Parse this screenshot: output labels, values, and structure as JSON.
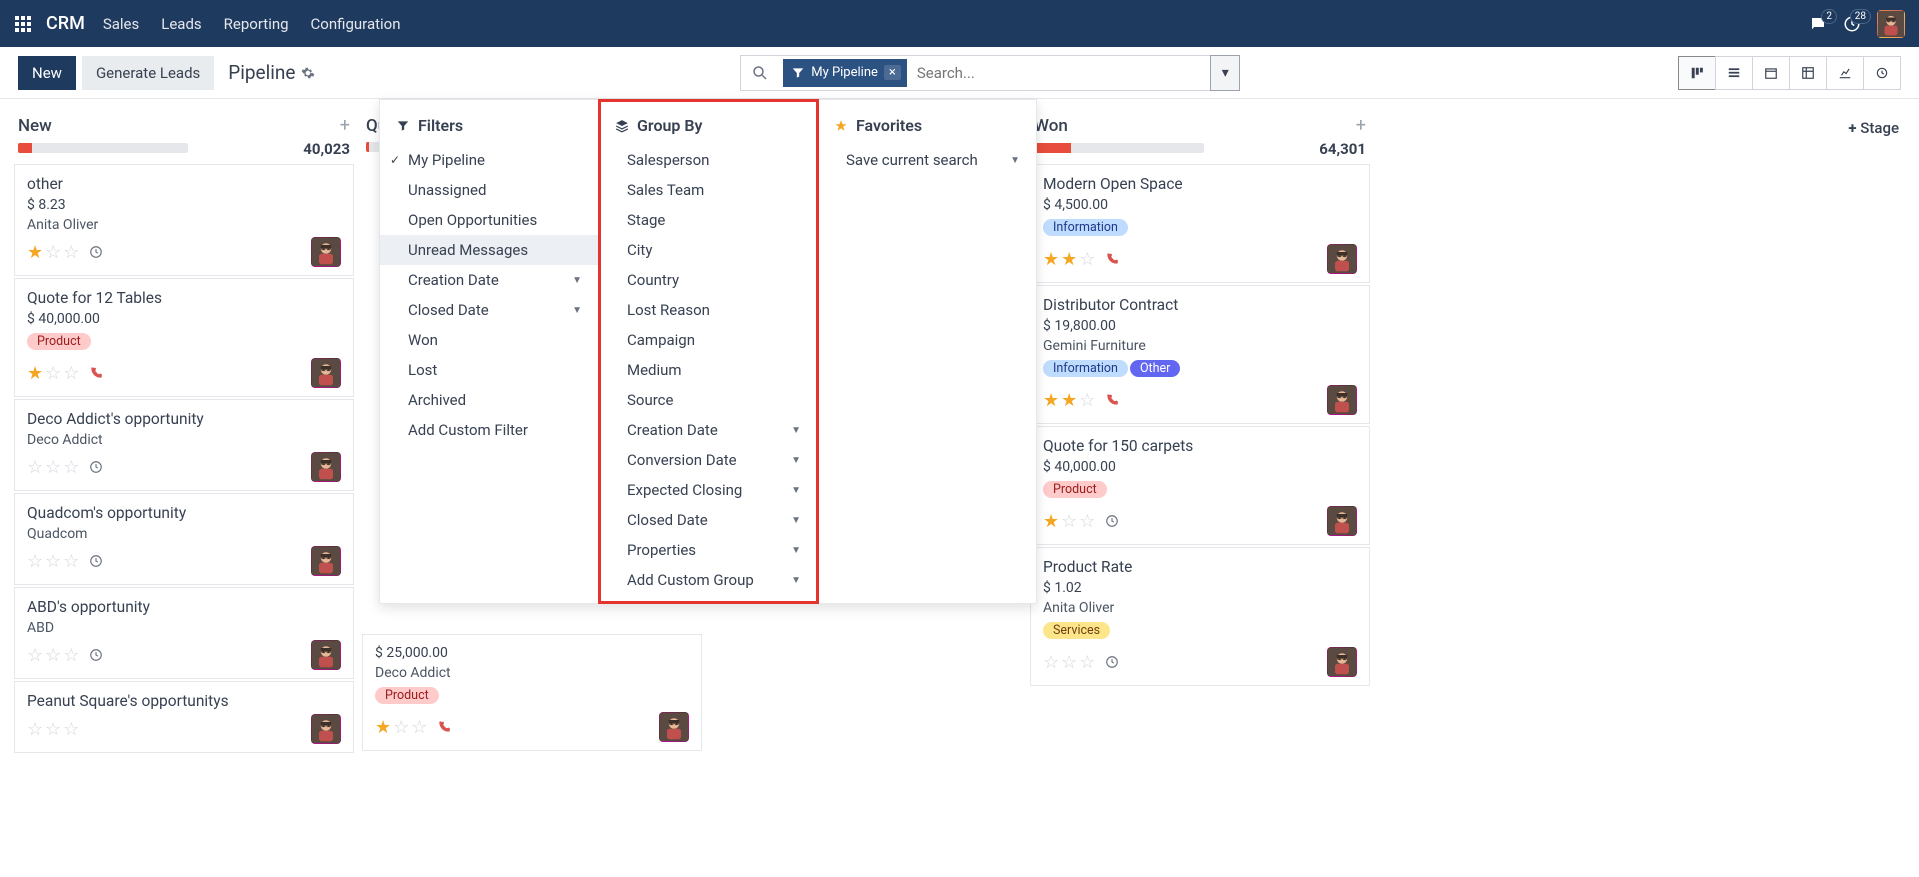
{
  "nav": {
    "brand": "CRM",
    "menu": [
      "Sales",
      "Leads",
      "Reporting",
      "Configuration"
    ],
    "msg_count": "2",
    "activity_count": "28"
  },
  "toolbar": {
    "new_label": "New",
    "generate_label": "Generate Leads",
    "title": "Pipeline",
    "chip_label": "My Pipeline",
    "search_placeholder": "Search...",
    "add_stage": "Stage"
  },
  "dropdown": {
    "filters_head": "Filters",
    "groupby_head": "Group By",
    "favorites_head": "Favorites",
    "filters": [
      {
        "label": "My Pipeline",
        "checked": true
      },
      {
        "label": "Unassigned"
      },
      {
        "label": "Open Opportunities"
      },
      {
        "label": "Unread Messages",
        "hovered": true
      },
      {
        "label": "Creation Date",
        "caret": true
      },
      {
        "label": "Closed Date",
        "caret": true
      },
      {
        "label": "Won"
      },
      {
        "label": "Lost"
      },
      {
        "label": "Archived"
      },
      {
        "label": "Add Custom Filter"
      }
    ],
    "groupby": [
      {
        "label": "Salesperson"
      },
      {
        "label": "Sales Team"
      },
      {
        "label": "Stage"
      },
      {
        "label": "City"
      },
      {
        "label": "Country"
      },
      {
        "label": "Lost Reason"
      },
      {
        "label": "Campaign"
      },
      {
        "label": "Medium"
      },
      {
        "label": "Source"
      },
      {
        "label": "Creation Date",
        "caret": true
      },
      {
        "label": "Conversion Date",
        "caret": true
      },
      {
        "label": "Expected Closing",
        "caret": true
      },
      {
        "label": "Closed Date",
        "caret": true
      },
      {
        "label": "Properties",
        "caret": true
      },
      {
        "label": "Add Custom Group",
        "caret": true
      }
    ],
    "favorites": [
      {
        "label": "Save current search",
        "caret": true
      }
    ]
  },
  "columns": [
    {
      "name": "New",
      "total": "40,023",
      "fillpct": 8,
      "cards": [
        {
          "title": "other",
          "amount": "$ 8.23",
          "subtitle": "Anita Oliver",
          "tags": [],
          "stars": 1,
          "icon": "clock"
        },
        {
          "title": "Quote for 12 Tables",
          "amount": "$ 40,000.00",
          "tags": [
            {
              "t": "Product",
              "c": "product"
            }
          ],
          "stars": 1,
          "icon": "phone"
        },
        {
          "title": "Deco Addict's opportunity",
          "subtitle": "Deco Addict",
          "tags": [],
          "stars": 0,
          "icon": "clock"
        },
        {
          "title": "Quadcom's opportunity",
          "subtitle": "Quadcom",
          "tags": [],
          "stars": 0,
          "icon": "clock"
        },
        {
          "title": "ABD's opportunity",
          "subtitle": "ABD",
          "tags": [],
          "stars": 0,
          "icon": "clock"
        },
        {
          "title": "Peanut Square's opportunitys",
          "tags": [],
          "stars": 0
        }
      ]
    },
    {
      "name": "Qualified",
      "total": "",
      "fillpct": 2,
      "spacer": true,
      "cards": [
        {
          "spacer_h": 470
        },
        {
          "amount": "$ 25,000.00",
          "subtitle": "Deco Addict",
          "tags": [
            {
              "t": "Product",
              "c": "product"
            }
          ],
          "stars": 1,
          "icon": "phone"
        }
      ]
    },
    {
      "name": "Won",
      "total": "64,301",
      "fillpct": 22,
      "shift": true,
      "cards": [
        {
          "title": "Modern Open Space",
          "amount": "$ 4,500.00",
          "tags": [
            {
              "t": "Information",
              "c": "info"
            }
          ],
          "stars": 2,
          "icon": "phone"
        },
        {
          "title": "Distributor Contract",
          "amount": "$ 19,800.00",
          "subtitle": "Gemini Furniture",
          "tags": [
            {
              "t": "Information",
              "c": "info"
            },
            {
              "t": "Other",
              "c": "other"
            }
          ],
          "stars": 2,
          "icon": "phone"
        },
        {
          "title": "Quote for 150 carpets",
          "amount": "$ 40,000.00",
          "tags": [
            {
              "t": "Product",
              "c": "product"
            }
          ],
          "stars": 1,
          "icon": "clock"
        },
        {
          "title": "Product Rate",
          "amount": "$ 1.02",
          "subtitle": "Anita Oliver",
          "tags": [
            {
              "t": "Services",
              "c": "services"
            }
          ],
          "stars": 0,
          "icon": "clock"
        }
      ]
    }
  ]
}
